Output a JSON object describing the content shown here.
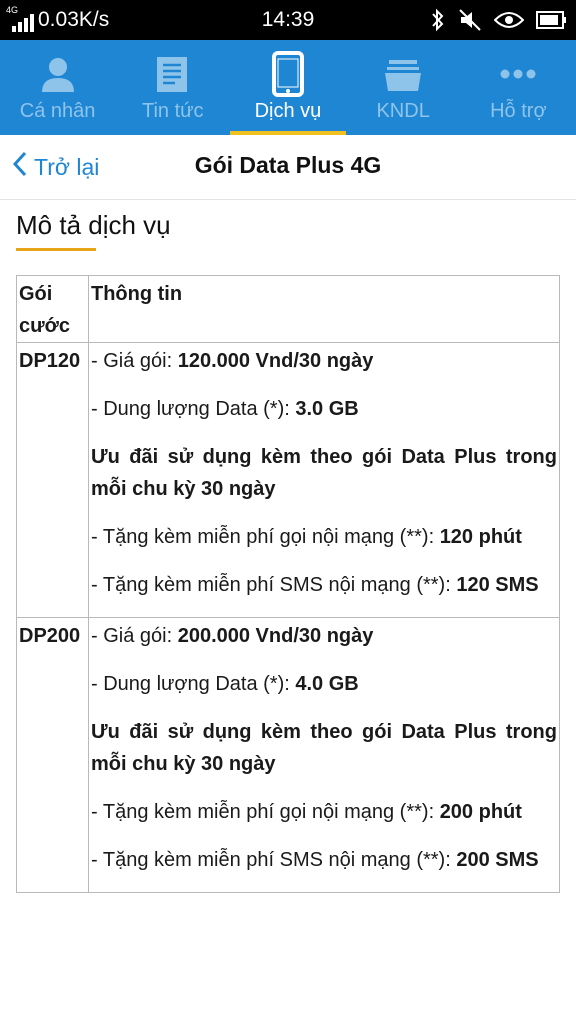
{
  "status_bar": {
    "network_type": "4G",
    "speed": "0.03K/s",
    "time": "14:39",
    "icons": [
      "bluetooth-icon",
      "mute-icon",
      "eye-icon",
      "battery-icon"
    ]
  },
  "tabs": [
    {
      "label": "Cá nhân",
      "icon": "person-icon",
      "active": false
    },
    {
      "label": "Tin tức",
      "icon": "news-icon",
      "active": false
    },
    {
      "label": "Dịch vụ",
      "icon": "phone-icon",
      "active": true
    },
    {
      "label": "KNDL",
      "icon": "folder-icon",
      "active": false
    },
    {
      "label": "Hỗ trợ",
      "icon": "more-icon",
      "active": false
    }
  ],
  "header": {
    "back_label": "Trở lại",
    "title": "Gói Data Plus 4G"
  },
  "section": {
    "heading": "Mô tả dịch vụ"
  },
  "table": {
    "col1_header": "Gói cước",
    "col2_header": "Thông tin",
    "rows": [
      {
        "plan": "DP120",
        "price_label": "- Giá gói: ",
        "price_value": "120.000 Vnd/30 ngày",
        "data_label": "- Dung lượng Data (*): ",
        "data_value": "3.0 GB",
        "offer": "Ưu đãi sử dụng kèm theo gói Data Plus trong mỗi chu kỳ 30 ngày",
        "calls_label": "- Tặng kèm miễn phí gọi nội mạng (**): ",
        "calls_value": "120 phút",
        "sms_label": "- Tặng kèm miễn phí SMS nội mạng (**): ",
        "sms_value": "120 SMS"
      },
      {
        "plan": "DP200",
        "price_label": "- Giá gói: ",
        "price_value": "200.000 Vnd/30 ngày",
        "data_label": "- Dung lượng Data (*): ",
        "data_value": "4.0 GB",
        "offer": "Ưu đãi sử dụng kèm theo gói Data Plus trong mỗi chu kỳ 30 ngày",
        "calls_label": "- Tặng kèm miễn phí gọi nội mạng (**): ",
        "calls_value": "200 phút",
        "sms_label": "- Tặng kèm miễn phí SMS nội mạng (**): ",
        "sms_value": "200 SMS"
      }
    ]
  },
  "colors": {
    "tab_bar": "#1f86d3",
    "tab_active_indicator": "#f0c020",
    "section_underline": "#e8a417",
    "link": "#1f86d3"
  }
}
